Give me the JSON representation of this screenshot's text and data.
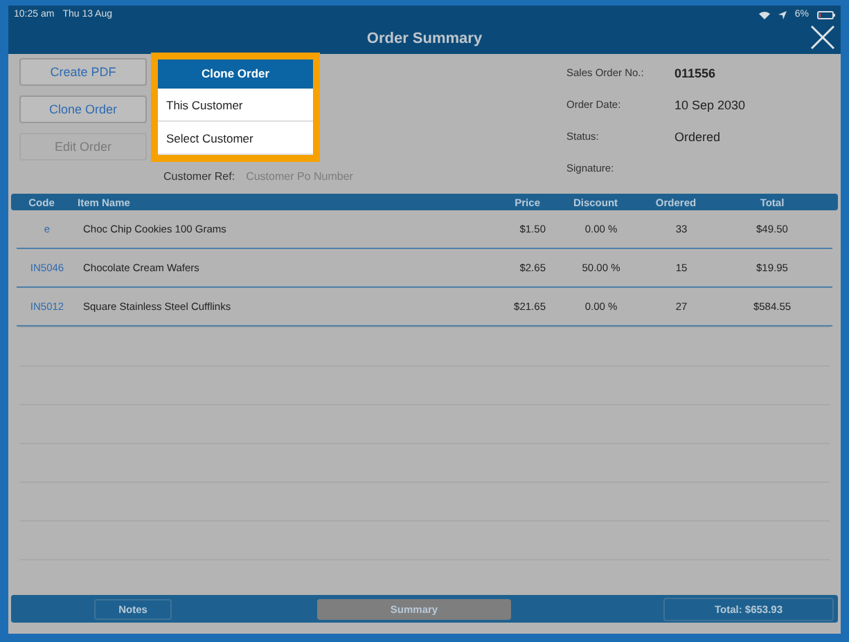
{
  "status_bar": {
    "time": "10:25 am",
    "date": "Thu 13 Aug",
    "battery": "6%"
  },
  "title": "Order Summary",
  "actions": [
    {
      "label": "Create PDF",
      "disabled": false
    },
    {
      "label": "Clone Order",
      "disabled": false
    },
    {
      "label": "Edit Order",
      "disabled": true
    }
  ],
  "customer_ref": {
    "label": "Customer Ref:",
    "placeholder": "Customer Po Number"
  },
  "order_info": [
    {
      "label": "Sales Order No.:",
      "value": "011556",
      "bold": true
    },
    {
      "label": "Order Date:",
      "value": "10 Sep 2030",
      "bold": false
    },
    {
      "label": "Status:",
      "value": "Ordered",
      "bold": false
    },
    {
      "label": "Signature:"
    }
  ],
  "table": {
    "columns": [
      "Code",
      "Item Name",
      "Price",
      "Discount",
      "Ordered",
      "Total"
    ],
    "rows": [
      [
        "e",
        "Choc Chip Cookies 100 Grams",
        "$1.50",
        "0.00 %",
        "33",
        "$49.50"
      ],
      [
        "IN5046",
        "Chocolate Cream Wafers",
        "$2.65",
        "50.00 %",
        "15",
        "$19.95"
      ],
      [
        "IN5012",
        "Square Stainless Steel Cufflinks",
        "$21.65",
        "0.00 %",
        "27",
        "$584.55"
      ]
    ]
  },
  "footer": {
    "tabs": [
      {
        "label": "Notes",
        "selected": false
      },
      {
        "label": "Summary",
        "selected": true
      }
    ],
    "total": "Total: $653.93"
  },
  "popover": {
    "title": "Clone Order",
    "items": [
      "This Customer",
      "Select Customer"
    ]
  }
}
